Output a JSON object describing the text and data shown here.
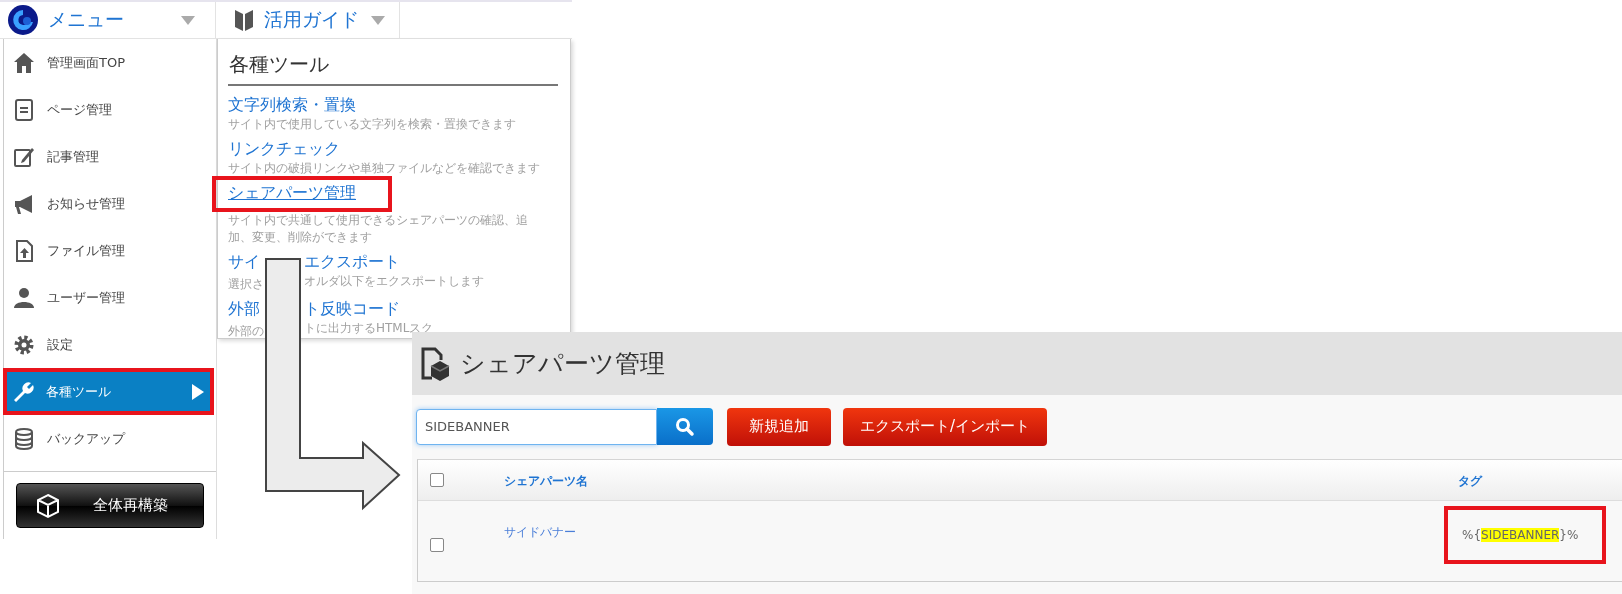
{
  "top_bar": {
    "menu_button": {
      "label": "メニュー"
    },
    "guide_button": {
      "label": "活用ガイド"
    }
  },
  "menu": {
    "items": [
      {
        "label": "管理画面TOP",
        "selected": false,
        "highlighted": false
      },
      {
        "label": "ページ管理",
        "selected": false,
        "highlighted": false
      },
      {
        "label": "記事管理",
        "selected": false,
        "highlighted": false
      },
      {
        "label": "お知らせ管理",
        "selected": false,
        "highlighted": false
      },
      {
        "label": "ファイル管理",
        "selected": false,
        "highlighted": false
      },
      {
        "label": "ユーザー管理",
        "selected": false,
        "highlighted": false
      },
      {
        "label": "設定",
        "selected": false,
        "highlighted": false
      },
      {
        "label": "各種ツール",
        "selected": true,
        "highlighted": true
      },
      {
        "label": "バックアップ",
        "selected": false,
        "highlighted": false
      }
    ],
    "rebuild_button": {
      "label": "全体再構築"
    }
  },
  "submenu": {
    "title": "各種ツール",
    "items": [
      {
        "title": [
          "文字列検索・置換"
        ],
        "description": [
          "サイト内で使用している文字列を検索・置換できます"
        ],
        "hovered": false,
        "highlighted": false
      },
      {
        "title": [
          "リンクチェック"
        ],
        "description": [
          "サイト内の破損リンクや単独ファイルなどを確認できます"
        ],
        "hovered": false,
        "highlighted": false
      },
      {
        "title": [
          "シェアパーツ管理"
        ],
        "description": [
          "サイト内で共通して使用できるシェアパーツの確認、追加、変更、削除ができます"
        ],
        "hovered": true,
        "highlighted": true
      },
      {
        "title": [
          "サイ",
          "エクスポート"
        ],
        "description": [
          "選択さ",
          "オルダ以下をエクスポートします"
        ],
        "hovered": false,
        "highlighted": false
      },
      {
        "title": [
          "外部",
          "ト反映コード"
        ],
        "description": [
          "外部の",
          "トに出力するHTMLスク"
        ],
        "hovered": false,
        "highlighted": false
      }
    ]
  },
  "share_parts_screen": {
    "title": "シェアパーツ管理",
    "search": {
      "value": "SIDEBANNER"
    },
    "buttons": [
      {
        "label": "新規追加"
      },
      {
        "label": "エクスポート/インポート"
      }
    ],
    "table": {
      "columns": [
        "シェアパーツ名",
        "タグ"
      ],
      "header_checked": false,
      "rows": [
        {
          "checked": false,
          "name": "サイドバナー",
          "tag": {
            "text_before": "%{",
            "highlight": "SIDEBANNER",
            "text_after": "}%"
          },
          "highlighted": true
        }
      ]
    }
  }
}
